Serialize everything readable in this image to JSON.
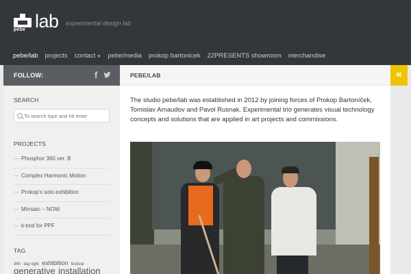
{
  "header": {
    "logo_small": "pebe",
    "logo_text": "lab",
    "tagline": "experimental design lab"
  },
  "nav": {
    "items": [
      {
        "label": "pebe/lab"
      },
      {
        "label": "projects"
      },
      {
        "label": "contact"
      },
      {
        "label": "pebe/media"
      },
      {
        "label": "prokop bartonicek"
      },
      {
        "label": "22PRESENTS showroom"
      },
      {
        "label": "merchandise"
      }
    ],
    "active_index": 0
  },
  "sidebar": {
    "follow_label": "FOLLOW:",
    "social_icons": [
      "facebook-icon",
      "twitter-icon"
    ],
    "search_title": "SEARCH",
    "search_placeholder": "To search type and hit enter",
    "projects_title": "PROJECTS",
    "projects": [
      {
        "label": "Phosphor 360 ver. B"
      },
      {
        "label": "Complex Harmonic Motion"
      },
      {
        "label": "Prokop's solo exhibition"
      },
      {
        "label": "Mirrsaic – NOW"
      },
      {
        "label": "k-tool for PPF"
      }
    ],
    "tag_title": "TAG",
    "tags": {
      "t1": "360",
      "t2": "day light",
      "t3": "exhibition",
      "t4": "festival",
      "t5": "generative",
      "t6": "installation"
    }
  },
  "content": {
    "title": "PEBE/LAB",
    "intro": "The studio pebe/lab was established in 2012 by joining forces of Prokop Bartoníček, Tomislav Arnaudov and Pavol Rusnak. Experimental trio generates visual technology concepts and solutions that are applied in art projects and commissions.",
    "collapse_icon": "double-chevron-left-icon"
  },
  "colors": {
    "header_bg": "#33363b",
    "accent": "#f0c300",
    "sidebar_head_bg": "#5a5d62",
    "sidebar_bg": "#f0f0f0"
  }
}
